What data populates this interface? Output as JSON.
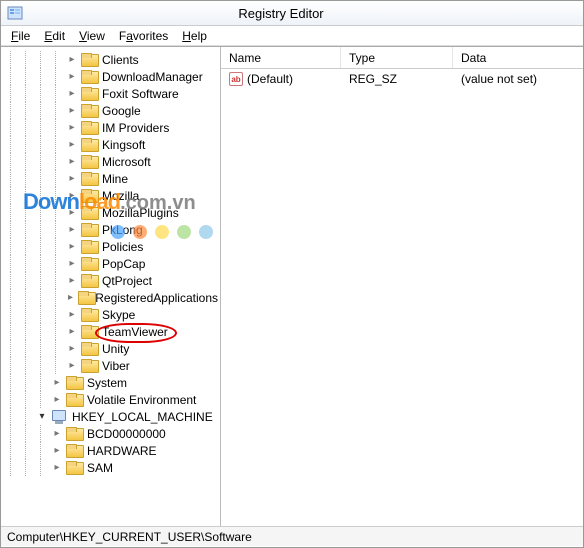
{
  "window": {
    "title": "Registry Editor"
  },
  "menu": {
    "file": "File",
    "edit": "Edit",
    "view": "View",
    "favorites": "Favorites",
    "help": "Help"
  },
  "columns": {
    "name": "Name",
    "type": "Type",
    "data": "Data"
  },
  "rows": [
    {
      "name": "(Default)",
      "type": "REG_SZ",
      "data": "(value not set)"
    }
  ],
  "tree": {
    "software_children": [
      "Clients",
      "DownloadManager",
      "Foxit Software",
      "Google",
      "IM Providers",
      "Kingsoft",
      "Microsoft",
      "Mine",
      "Mozilla",
      "MozillaPlugins",
      "PkLong",
      "Policies",
      "PopCap",
      "QtProject",
      "RegisteredApplications",
      "Skype",
      "TeamViewer",
      "Unity",
      "Viber"
    ],
    "siblings_after": [
      "System",
      "Volatile Environment"
    ],
    "hklm": {
      "label": "HKEY_LOCAL_MACHINE",
      "children": [
        "BCD00000000",
        "HARDWARE",
        "SAM"
      ]
    }
  },
  "statusbar": "Computer\\HKEY_CURRENT_USER\\Software",
  "watermark": {
    "brand1": "Down",
    "brand2": "load",
    "suffix": ".com.vn"
  },
  "highlighted": "TeamViewer"
}
